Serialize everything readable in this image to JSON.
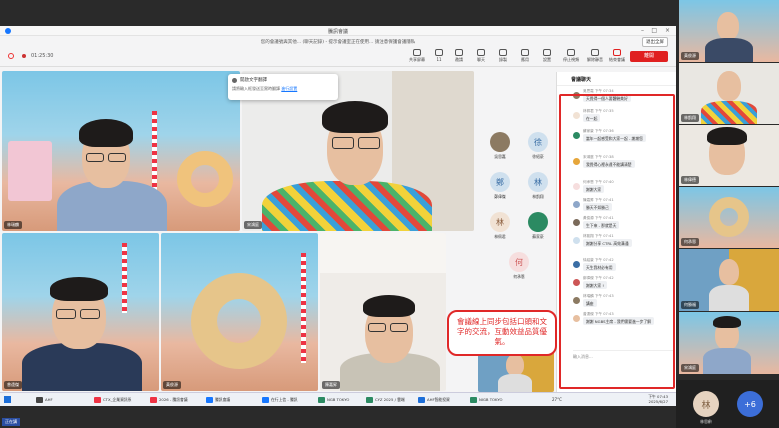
{
  "window": {
    "title": "騰訊會議"
  },
  "banner": {
    "text": "您的會議號與其他... (聊天記錄) - 提示會議室正在使用... 請注意保護會議隱私",
    "exit_label": "退出全屏"
  },
  "toolbar": {
    "time": "01:25:30",
    "buttons": [
      {
        "label": "共享屏幕"
      },
      {
        "label": "管理成員"
      },
      {
        "label": "邀請"
      },
      {
        "label": "聊天"
      },
      {
        "label": "錄製"
      },
      {
        "label": "應用"
      },
      {
        "label": "設置"
      },
      {
        "label": "視圖"
      },
      {
        "label": "停止視頻"
      },
      {
        "label": "解除靜音"
      },
      {
        "label": "結束會議"
      }
    ],
    "participant_count": "11",
    "leave_label": "離開"
  },
  "tooltip": {
    "title": "開啟文字翻譯",
    "body": "請將輸入框發送至實時翻譯",
    "link": "進行設置"
  },
  "tiles": [
    {
      "name": "林瑞麟"
    },
    {
      "name": "宋鴻庭"
    },
    {
      "name": "曾遠傑"
    },
    {
      "name": "黃俊源"
    },
    {
      "name": "陳嘉昇"
    }
  ],
  "avatars": [
    {
      "char": "",
      "name": "吳思嘉"
    },
    {
      "char": "徐",
      "name": "徐紹豪"
    },
    {
      "char": "鄭",
      "name": "鄭偉傑"
    },
    {
      "char": "林",
      "name": "林凱翔"
    },
    {
      "char": "林",
      "name": "林佩君"
    },
    {
      "char": "",
      "name": "蘇家豪"
    },
    {
      "char": "何",
      "name": "何承恩"
    }
  ],
  "chat": {
    "title": "會議聊天",
    "messages": [
      {
        "who": "吳思嘉  下午 07:34",
        "text": "天覺得一個人要體驗美好"
      },
      {
        "who": "林佩君  下午 07:35",
        "text": "在一起"
      },
      {
        "who": "蘇家豪  下午 07:36",
        "text": "當年一起感受和大家一起 - 謝謝您"
      },
      {
        "who": "宋鴻庭  下午 07:38",
        "text": "我覺得心裡永遠不能講清楚"
      },
      {
        "who": "何承恩  下午 07:40",
        "text": "謝謝大家"
      },
      {
        "who": "陳嘉昇  下午 07:41",
        "text": "勝天不如勝己"
      },
      {
        "who": "黃俊源  下午 07:41",
        "text": "生下來 - 那就是天"
      },
      {
        "who": "林凱翔  下午 07:41",
        "text": "謝謝分享 CTRL 高效溝通"
      },
      {
        "who": "徐紹豪  下午 07:42",
        "text": "天生我材必有用"
      },
      {
        "who": "鄭偉傑  下午 07:42",
        "text": "謝謝大家 !"
      },
      {
        "who": "林瑞麟  下午 07:43",
        "text": "講座"
      },
      {
        "who": "曾遠傑  下午 07:43",
        "text": "謝謝 NGBS主席 - 我們需要進一步了解"
      }
    ],
    "input_placeholder": "輸入消息..."
  },
  "callout": {
    "text": "會議線上同步包括口頭和文字的交流，互動效益品質優氣。"
  },
  "taskbar": {
    "items": [
      "AHF",
      "CTX_企業資訊系",
      "2026 - 騰訊會議",
      "騰訊會議",
      "在行上信 - 騰訊",
      "NGB TOKYO",
      "CYZ 2025 / 雲端",
      "AHF智能投資",
      "NIGB TOKYO"
    ],
    "clock_time": "下午 07:43",
    "clock_date": "2025/6/27",
    "temp": "27°C"
  },
  "strip": [
    {
      "name": "黃俊源"
    },
    {
      "name": "林凱翔"
    },
    {
      "name": "林偉德"
    },
    {
      "name": "何承恩"
    },
    {
      "name": "何勝福"
    },
    {
      "name": "宋鴻庭"
    }
  ],
  "bottom": {
    "avatar_char": "林",
    "name": "林思齡",
    "more": "+6",
    "tag": "正在講"
  }
}
